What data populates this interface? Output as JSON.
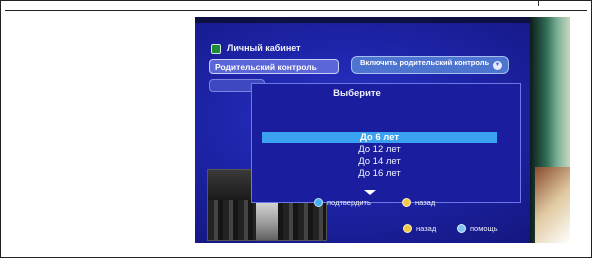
{
  "tv_menu": {
    "section_title": "Личный кабинет",
    "active_menu_item": "Родительский контроль",
    "enable_button": "Включить родительский контроль",
    "dialog": {
      "title": "Выберите",
      "options": [
        "До 6 лет",
        "До 12 лет",
        "До 14 лет",
        "До 16 лет"
      ],
      "selected_index": 0,
      "hints": {
        "confirm": "подтвердить",
        "back": "назад"
      }
    },
    "footer": {
      "back": "назад",
      "help": "помощь"
    }
  },
  "colors": {
    "screen_blue": "#1d23a6",
    "highlight": "#3aa2f0",
    "button_blue": "#5b66d8"
  }
}
